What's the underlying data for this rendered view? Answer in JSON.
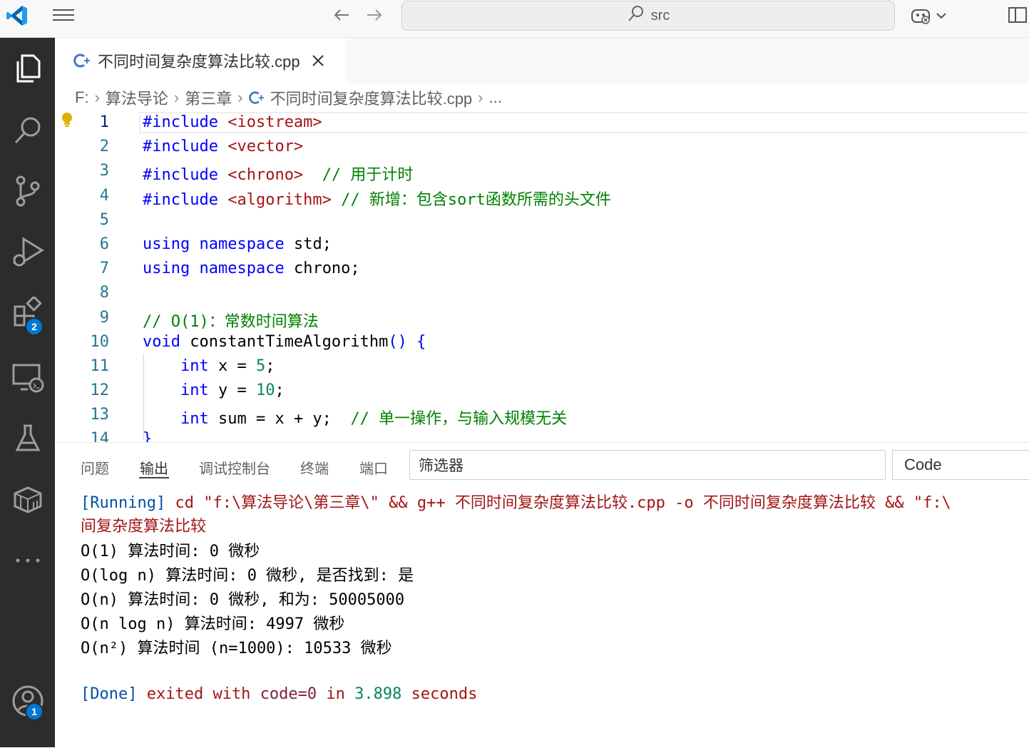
{
  "titlebar": {
    "search_text": "src"
  },
  "activity": {
    "extensions_badge": "2",
    "accounts_badge": "1"
  },
  "tab": {
    "title": "不同时间复杂度算法比较.cpp"
  },
  "breadcrumb": {
    "drive": "F:",
    "folder1": "算法导论",
    "folder2": "第三章",
    "file": "不同时间复杂度算法比较.cpp",
    "more": "..."
  },
  "editor": {
    "line_numbers": [
      "1",
      "2",
      "3",
      "4",
      "5",
      "6",
      "7",
      "8",
      "9",
      "10",
      "11",
      "12",
      "13",
      "14"
    ],
    "lines": {
      "l1_kw": "#include",
      "l1_inc": "<iostream>",
      "l2_kw": "#include",
      "l2_inc": "<vector>",
      "l3_kw": "#include",
      "l3_inc": "<chrono>",
      "l3_cm": "// 用于计时",
      "l4_kw": "#include",
      "l4_inc": "<algorithm>",
      "l4_cm": "// 新增：包含sort函数所需的头文件",
      "l6_kw1": "using",
      "l6_kw2": "namespace",
      "l6_rest": "std;",
      "l7_kw1": "using",
      "l7_kw2": "namespace",
      "l7_rest": "chrono;",
      "l9_cm": "// O(1)：常数时间算法",
      "l10_kw": "void",
      "l10_fn": "constantTimeAlgorithm",
      "l10_paren": "()",
      "l10_brace": "{",
      "l11_ty": "int",
      "l11_mid": "x =",
      "l11_num": "5",
      "l11_end": ";",
      "l12_ty": "int",
      "l12_mid": "y =",
      "l12_num": "10",
      "l12_end": ";",
      "l13_ty": "int",
      "l13_mid": "sum = x + y;",
      "l13_cm": "// 单一操作，与输入规模无关",
      "l14": "}"
    }
  },
  "panel": {
    "tabs": [
      "问题",
      "输出",
      "调试控制台",
      "终端",
      "端口"
    ],
    "filter_placeholder": "筛选器",
    "channel": "Code",
    "output": {
      "running_tag": "[Running]",
      "running_cmd": "cd \"f:\\算法导论\\第三章\\\" && g++ 不同时间复杂度算法比较.cpp -o 不同时间复杂度算法比较 && \"f:\\",
      "running_cont": "间复杂度算法比较",
      "r1": "O(1) 算法时间: 0 微秒",
      "r2": "O(log n) 算法时间: 0 微秒, 是否找到: 是",
      "r3": "O(n) 算法时间: 0 微秒, 和为: 50005000",
      "r4": "O(n log n) 算法时间: 4997 微秒",
      "r5": "O(n²) 算法时间 (n=1000): 10533 微秒",
      "done_tag": "[Done]",
      "done_exited": "exited with",
      "done_code": "code=0",
      "done_in": "in",
      "done_secs": "3.898",
      "done_seconds": "seconds"
    }
  }
}
